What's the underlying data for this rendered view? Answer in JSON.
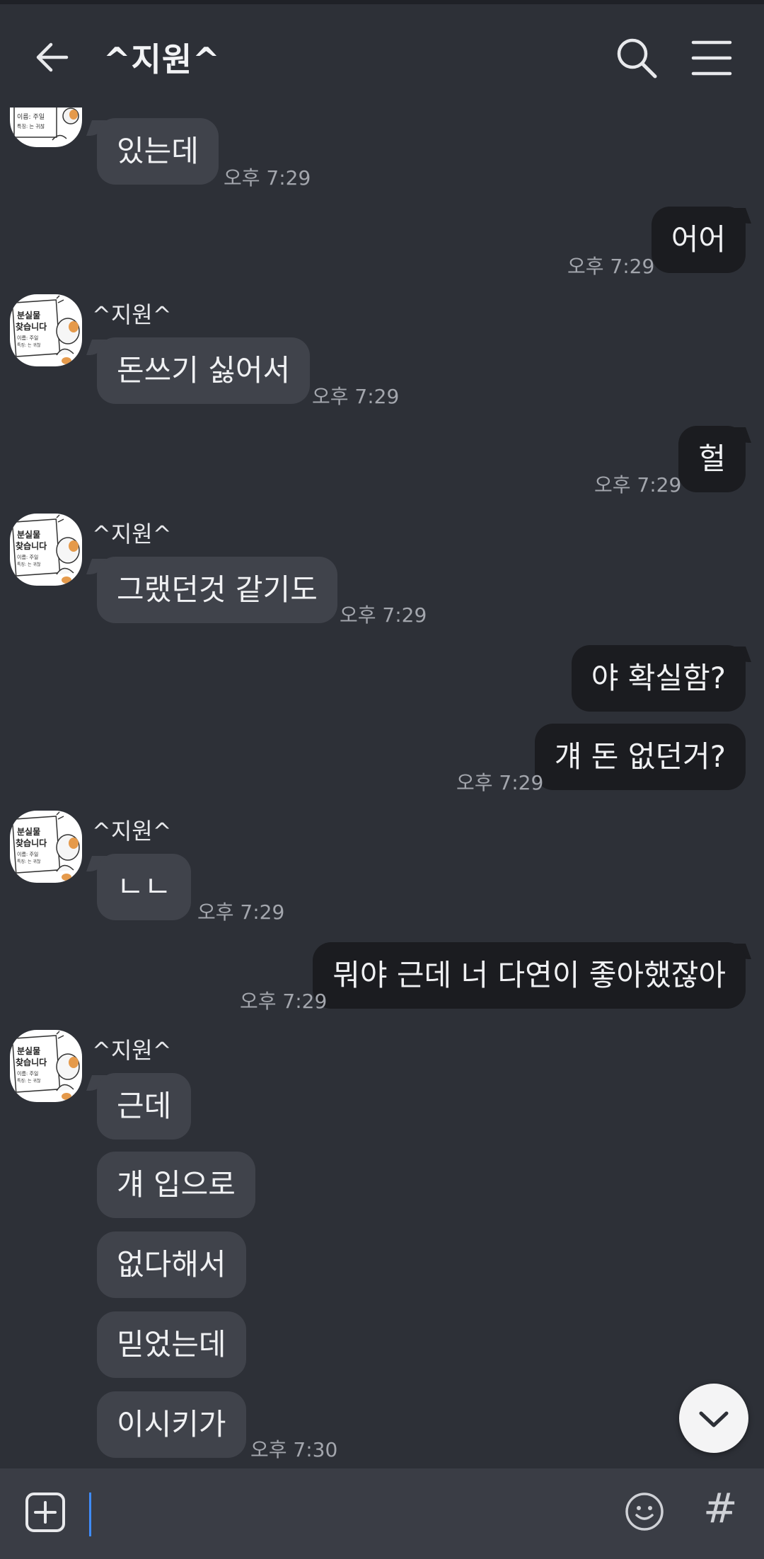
{
  "header": {
    "title": "^지원^",
    "back_icon": "arrow-left-icon",
    "search_icon": "search-icon",
    "menu_icon": "hamburger-menu-icon"
  },
  "contact": {
    "name": "^지원^",
    "avatar_text_1": "분실물",
    "avatar_text_2": "찾습니다"
  },
  "messages": [
    {
      "from": "them",
      "text": "있는데",
      "time": "오후 7:29"
    },
    {
      "from": "me",
      "text": "어어",
      "time": "오후 7:29"
    },
    {
      "from": "them",
      "sender": "^지원^",
      "text": "돈쓰기 싫어서",
      "time": "오후 7:29"
    },
    {
      "from": "me",
      "text": "헐",
      "time": "오후 7:29"
    },
    {
      "from": "them",
      "sender": "^지원^",
      "text": "그랬던것 같기도",
      "time": "오후 7:29"
    },
    {
      "from": "me",
      "text": "야 확실함?"
    },
    {
      "from": "me",
      "text": "걔 돈 없던거?",
      "time": "오후 7:29"
    },
    {
      "from": "them",
      "sender": "^지원^",
      "text": "ㄴㄴ",
      "time": "오후 7:29"
    },
    {
      "from": "me",
      "text": "뭐야 근데 너 다연이 좋아했잖아",
      "time": "오후 7:29"
    },
    {
      "from": "them",
      "sender": "^지원^",
      "text": "근데"
    },
    {
      "from": "them",
      "text": "걔 입으로"
    },
    {
      "from": "them",
      "text": "없다해서"
    },
    {
      "from": "them",
      "text": "믿었는데"
    },
    {
      "from": "them",
      "text": "이시키가",
      "time": "오후 7:30"
    }
  ],
  "input": {
    "value": "",
    "placeholder": "",
    "plus_icon": "plus-square-icon",
    "emoji_icon": "smiley-icon",
    "hash_label": "#"
  },
  "scroll_down_icon": "chevron-down-icon",
  "colors": {
    "background": "#2d3037",
    "their_bubble": "#40434b",
    "my_bubble": "#1b1c20",
    "time_text": "#a3a6ad",
    "input_bar": "#3a3d45",
    "cursor": "#3f8cff"
  }
}
